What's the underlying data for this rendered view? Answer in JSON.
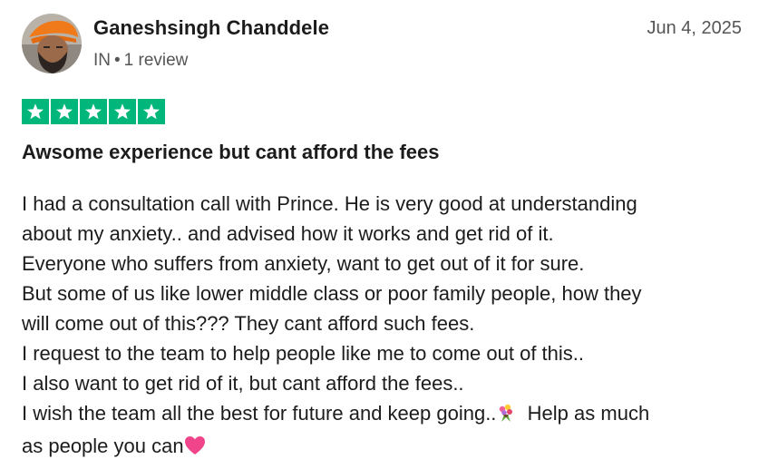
{
  "reviewer": {
    "name": "Ganeshsingh Chanddele",
    "country": "IN",
    "separator": "•",
    "review_count": "1 review",
    "avatar_icon": "avatar-photo"
  },
  "review": {
    "date": "Jun 4, 2025",
    "rating": 5,
    "rating_color": "#00b67a",
    "title": "Awsome experience but cant afford the fees",
    "lines": [
      "I had a consultation call with Prince. He is very good at understanding",
      "about my anxiety.. and advised how it works and get rid of it.",
      "Everyone who suffers from anxiety, want to get out of it for sure.",
      "But some of us like lower middle class or poor family people, how they",
      "will come out of this??? They cant afford such fees.",
      "I request to the team to help people like me to come out of this..",
      "I also want to get rid of it, but cant afford the fees..",
      "I wish the team all the best for future and keep going..",
      "Help as much",
      "as people you can"
    ],
    "emojis": [
      "bouquet-icon",
      "heart-icon"
    ]
  }
}
